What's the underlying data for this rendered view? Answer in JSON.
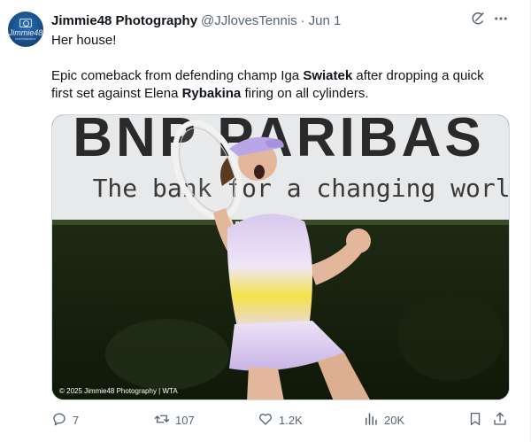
{
  "author": {
    "display_name": "Jimmie48 Photography",
    "handle": "@JJlovesTennis",
    "separator": "·",
    "date": "Jun 1",
    "avatar_text": "Jimmie48",
    "avatar_subtext": "PHOTOGRAPHY"
  },
  "tweet": {
    "line1": "Her house!",
    "line2_a": "Epic comeback from defending champ Iga ",
    "line2_b": "Swiatek",
    "line2_c": " after dropping a quick",
    "line3_a": "first set against Elena ",
    "line3_b": "Rybakina",
    "line3_c": " firing on all cylinders."
  },
  "media": {
    "banner_title": "BNP PARIBAS",
    "banner_tagline": "The bank for a changing world",
    "credit": "© 2025 Jimmie48 Photography | WTA"
  },
  "actions": {
    "replies": "7",
    "reposts": "107",
    "likes": "1.2K",
    "views": "20K"
  },
  "colors": {
    "text_primary": "#0f1419",
    "text_secondary": "#536471",
    "border": "#cfd9de",
    "avatar_blue": "#1a4f8a",
    "outfit_lavender": "#d8c8ee",
    "outfit_yellow": "#f3e34a"
  },
  "icons": [
    "grok-icon",
    "more-icon",
    "reply-icon",
    "repost-icon",
    "like-icon",
    "views-icon",
    "bookmark-icon",
    "share-icon"
  ]
}
